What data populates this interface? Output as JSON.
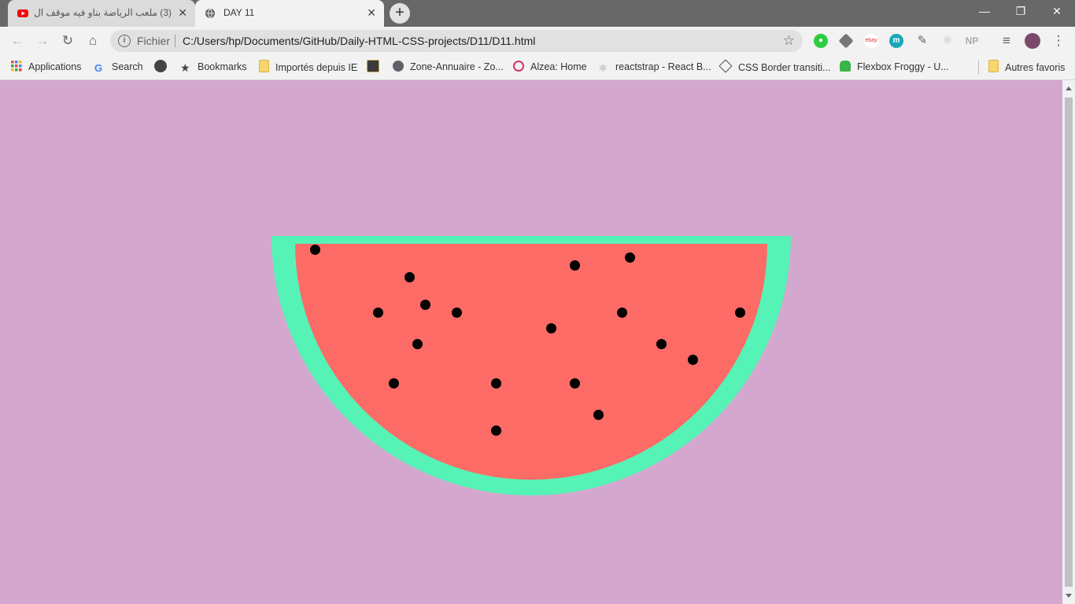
{
  "tabs": [
    {
      "title": "(3) ملعب الرياضة بناو فيه موقف ال",
      "favicon": "youtube-icon",
      "active": false
    },
    {
      "title": "DAY 11",
      "favicon": "globe-icon",
      "active": true
    }
  ],
  "toolbar": {
    "scheme_label": "Fichier",
    "url": "C:/Users/hp/Documents/GitHub/Daily-HTML-CSS-projects/D11/D11.html"
  },
  "bookmarks": {
    "items": [
      {
        "label": "Applications",
        "icon": "apps-grid-icon"
      },
      {
        "label": "Search",
        "icon": "google-icon"
      },
      {
        "label": "",
        "icon": "dark-circle-icon"
      },
      {
        "label": "Bookmarks",
        "icon": "star-icon"
      },
      {
        "label": "Importés depuis IE",
        "icon": "folder-icon"
      },
      {
        "label": "",
        "icon": "dark-square-icon"
      },
      {
        "label": "Zone-Annuaire - Zo...",
        "icon": "globe-icon"
      },
      {
        "label": "Alzea: Home",
        "icon": "alzea-icon"
      },
      {
        "label": "reactstrap - React B...",
        "icon": "react-icon"
      },
      {
        "label": "CSS Border transiti...",
        "icon": "codepen-icon"
      },
      {
        "label": "Flexbox Froggy - U...",
        "icon": "frog-icon"
      }
    ],
    "other": {
      "label": "Autres favoris",
      "icon": "folder-icon"
    }
  },
  "extensions": [
    "green-extension-icon",
    "layers-extension-icon",
    "ebay-extension-icon",
    "m-extension-icon",
    "eyedropper-extension-icon",
    "react-devtools-icon",
    "np-extension-icon"
  ],
  "colors": {
    "background": "#d4a7cf",
    "rind": "#56f3b6",
    "flesh": "#fd6b66",
    "seed": "#000000"
  }
}
